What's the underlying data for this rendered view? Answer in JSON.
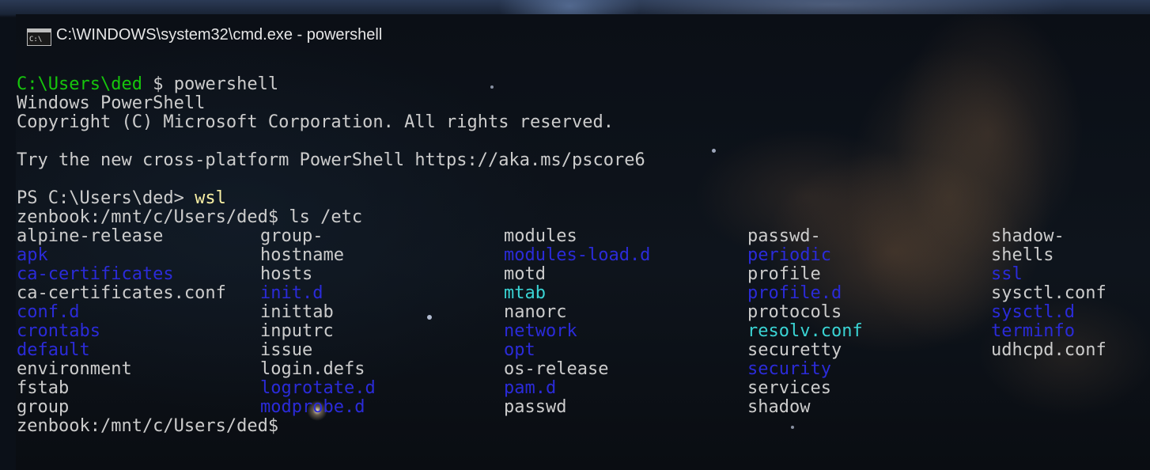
{
  "window": {
    "title": "C:\\WINDOWS\\system32\\cmd.exe - powershell",
    "icon": "cmd-console-icon"
  },
  "terminal": {
    "cmd_prompt": "C:\\Users\\ded",
    "cmd_prompt_symbol": " $ ",
    "cmd_command": "powershell",
    "ps_banner_1": "Windows PowerShell",
    "ps_banner_2": "Copyright (C) Microsoft Corporation. All rights reserved.",
    "ps_banner_3": "Try the new cross-platform PowerShell https://aka.ms/pscore6",
    "ps_prompt": "PS C:\\Users\\ded> ",
    "ps_command": "wsl",
    "wsl_prompt_1": "zenbook:/mnt/c/Users/ded$ ",
    "wsl_command": "ls /etc",
    "wsl_prompt_2": "zenbook:/mnt/c/Users/ded$"
  },
  "colors": {
    "file": "#cccccc",
    "directory": "#2b2bd9",
    "symlink": "#3ad4d4",
    "cmd_prompt": "#16c60c",
    "ps_command": "#f9f1a5"
  },
  "ls_columns": [
    [
      {
        "name": "alpine-release",
        "type": "file"
      },
      {
        "name": "apk",
        "type": "dir"
      },
      {
        "name": "ca-certificates",
        "type": "dir"
      },
      {
        "name": "ca-certificates.conf",
        "type": "file"
      },
      {
        "name": "conf.d",
        "type": "dir"
      },
      {
        "name": "crontabs",
        "type": "dir"
      },
      {
        "name": "default",
        "type": "dir"
      },
      {
        "name": "environment",
        "type": "file"
      },
      {
        "name": "fstab",
        "type": "file"
      },
      {
        "name": "group",
        "type": "file"
      }
    ],
    [
      {
        "name": "group-",
        "type": "file"
      },
      {
        "name": "hostname",
        "type": "file"
      },
      {
        "name": "hosts",
        "type": "file"
      },
      {
        "name": "init.d",
        "type": "dir"
      },
      {
        "name": "inittab",
        "type": "file"
      },
      {
        "name": "inputrc",
        "type": "file"
      },
      {
        "name": "issue",
        "type": "file"
      },
      {
        "name": "login.defs",
        "type": "file"
      },
      {
        "name": "logrotate.d",
        "type": "dir"
      },
      {
        "name": "modprobe.d",
        "type": "dir"
      }
    ],
    [
      {
        "name": "modules",
        "type": "file"
      },
      {
        "name": "modules-load.d",
        "type": "dir"
      },
      {
        "name": "motd",
        "type": "file"
      },
      {
        "name": "mtab",
        "type": "link"
      },
      {
        "name": "nanorc",
        "type": "file"
      },
      {
        "name": "network",
        "type": "dir"
      },
      {
        "name": "opt",
        "type": "dir"
      },
      {
        "name": "os-release",
        "type": "file"
      },
      {
        "name": "pam.d",
        "type": "dir"
      },
      {
        "name": "passwd",
        "type": "file"
      }
    ],
    [
      {
        "name": "passwd-",
        "type": "file"
      },
      {
        "name": "periodic",
        "type": "dir"
      },
      {
        "name": "profile",
        "type": "file"
      },
      {
        "name": "profile.d",
        "type": "dir"
      },
      {
        "name": "protocols",
        "type": "file"
      },
      {
        "name": "resolv.conf",
        "type": "link"
      },
      {
        "name": "securetty",
        "type": "file"
      },
      {
        "name": "security",
        "type": "dir"
      },
      {
        "name": "services",
        "type": "file"
      },
      {
        "name": "shadow",
        "type": "file"
      }
    ],
    [
      {
        "name": "shadow-",
        "type": "file"
      },
      {
        "name": "shells",
        "type": "file"
      },
      {
        "name": "ssl",
        "type": "dir"
      },
      {
        "name": "sysctl.conf",
        "type": "file"
      },
      {
        "name": "sysctl.d",
        "type": "dir"
      },
      {
        "name": "terminfo",
        "type": "dir"
      },
      {
        "name": "udhcpd.conf",
        "type": "file"
      }
    ]
  ]
}
